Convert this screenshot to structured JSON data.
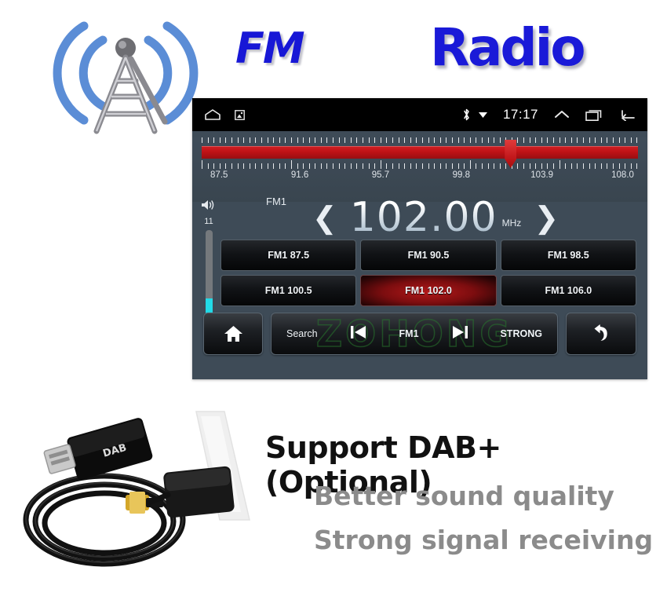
{
  "banner": {
    "fm_text": "FM",
    "radio_text": "Radio",
    "antenna_icon": "radio-tower-icon"
  },
  "device": {
    "status_bar": {
      "home_icon": "home-outline-icon",
      "screenshot_icon": "screenshot-icon",
      "bluetooth_icon": "bluetooth-icon",
      "dropdown_icon": "triangle-down-icon",
      "time": "17:17",
      "expand_icon": "chevron-up-icon",
      "recents_icon": "recents-icon",
      "back_icon": "back-arrow-icon"
    },
    "tuner": {
      "scale_labels": [
        "87.5",
        "91.6",
        "95.7",
        "99.8",
        "103.9",
        "108.0"
      ],
      "scale_min": 87.5,
      "scale_max": 108.0,
      "needle_value": 102.0,
      "bar_color": "#c01216",
      "needle_color": "#c4191d"
    },
    "volume": {
      "speaker_icon": "volume-icon",
      "value": "11",
      "level_percent": 40,
      "fill_color": "#22dbe8"
    },
    "frequency": {
      "band": "FM1",
      "prev_icon": "chevron-left-icon",
      "value": "102.00",
      "unit": "MHz",
      "next_icon": "chevron-right-icon"
    },
    "presets": [
      {
        "label": "FM1 87.5",
        "active": false
      },
      {
        "label": "FM1 90.5",
        "active": false
      },
      {
        "label": "FM1 98.5",
        "active": false
      },
      {
        "label": "FM1 100.5",
        "active": false
      },
      {
        "label": "FM1 102.0",
        "active": true
      },
      {
        "label": "FM1 106.0",
        "active": false
      }
    ],
    "toolbar": {
      "home_icon": "home-filled-icon",
      "search_label": "Search",
      "prev_icon": "skip-previous-icon",
      "band_label": "FM1",
      "next_icon": "skip-next-icon",
      "strong_label": "STRONG",
      "back_icon": "undo-arrow-icon",
      "watermark": "ZOHONG"
    }
  },
  "bottom": {
    "usb_antenna_icon": "usb-dab-antenna-icon",
    "title": "Support DAB+(Optional)",
    "line1": "Better sound quality",
    "line2": "Strong signal receiving",
    "title_color": "#111111",
    "subtitle_color": "#8b8b8b"
  }
}
